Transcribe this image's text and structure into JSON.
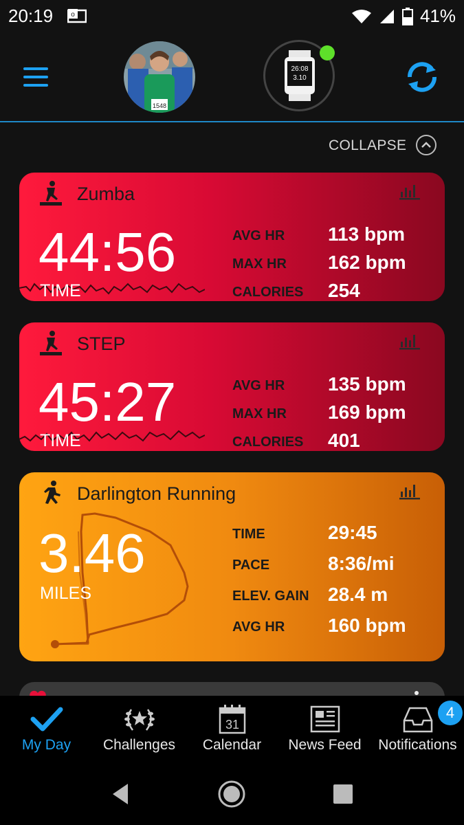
{
  "status_bar": {
    "time": "20:19",
    "battery": "41%"
  },
  "header": {
    "menu_icon": "hamburger-icon",
    "sync_icon": "sync-icon",
    "watch_time_top": "26:08",
    "watch_time_bottom": "3.10"
  },
  "collapse": {
    "label": "COLLAPSE"
  },
  "cards": [
    {
      "title": "Zumba",
      "big_value": "44:56",
      "big_label": "TIME",
      "stats": [
        {
          "label": "AVG HR",
          "value": "113 bpm"
        },
        {
          "label": "MAX HR",
          "value": "162 bpm"
        },
        {
          "label": "CALORIES",
          "value": "254"
        }
      ]
    },
    {
      "title": "STEP",
      "big_value": "45:27",
      "big_label": "TIME",
      "stats": [
        {
          "label": "AVG HR",
          "value": "135 bpm"
        },
        {
          "label": "MAX HR",
          "value": "169 bpm"
        },
        {
          "label": "CALORIES",
          "value": "401"
        }
      ]
    },
    {
      "title": "Darlington Running",
      "big_value": "3.46",
      "big_label": "MILES",
      "stats": [
        {
          "label": "TIME",
          "value": "29:45"
        },
        {
          "label": "PACE",
          "value": "8:36/mi"
        },
        {
          "label": "ELEV. GAIN",
          "value": "28.4 m"
        },
        {
          "label": "AVG HR",
          "value": "160 bpm"
        }
      ]
    }
  ],
  "bottom_nav": {
    "items": [
      {
        "label": "My Day",
        "icon": "checkmark-icon",
        "active": true
      },
      {
        "label": "Challenges",
        "icon": "laurel-icon"
      },
      {
        "label": "Calendar",
        "icon": "calendar-icon",
        "calendar_day": "31"
      },
      {
        "label": "News Feed",
        "icon": "newspaper-icon"
      },
      {
        "label": "Notifications",
        "icon": "inbox-icon",
        "badge": "4"
      }
    ]
  },
  "colors": {
    "accent": "#1da1f2",
    "card_red": "#e8103a",
    "card_orange": "#f5900e",
    "online_dot": "#5ee02a"
  }
}
